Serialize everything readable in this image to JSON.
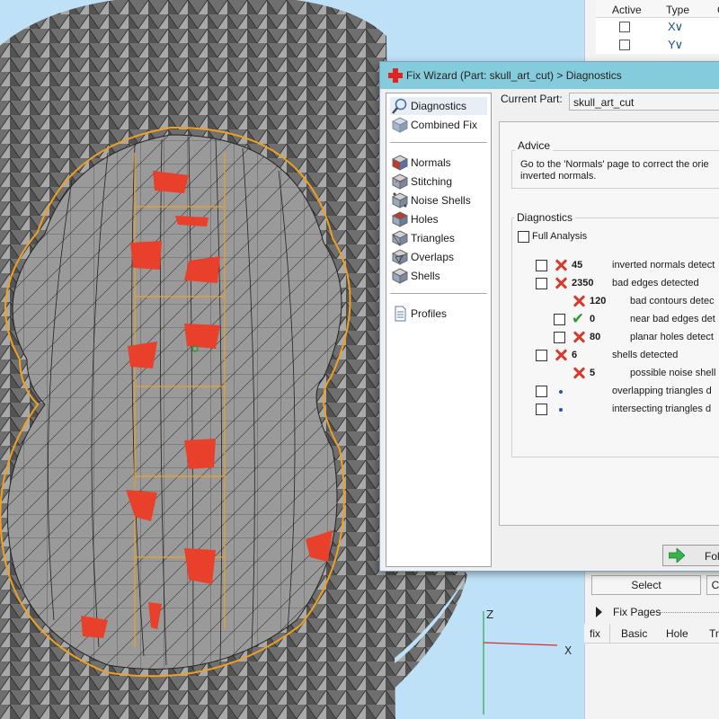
{
  "side_panel": {
    "columns": [
      "Active",
      "Type",
      "C"
    ],
    "rows": [
      {
        "active": false,
        "type_glyph": "X∨"
      },
      {
        "active": false,
        "type_glyph": "Y∨"
      }
    ],
    "select_label": "Select",
    "second_button_label": "C",
    "fix_pages_label": "Fix Pages",
    "tabs": [
      "fix",
      "Basic",
      "Hole",
      "Tri"
    ]
  },
  "viewport": {
    "axis_labels": {
      "z": "Z",
      "x": "X"
    },
    "colors": {
      "mesh": "#8c8c8c",
      "edges": "#1e1e1e",
      "highlight": "#f0a020",
      "bad_triangles": "#e8402a",
      "background": "#bfe1f7"
    }
  },
  "dialog": {
    "title": "Fix Wizard (Part: skull_art_cut) > Diagnostics",
    "nav": [
      {
        "label": "Diagnostics",
        "icon": "magnifier-icon",
        "selected": true
      },
      {
        "label": "Combined Fix",
        "icon": "cube-icon"
      },
      {
        "label": "Normals",
        "icon": "normals-cube-icon"
      },
      {
        "label": "Stitching",
        "icon": "stitching-cube-icon"
      },
      {
        "label": "Noise Shells",
        "icon": "noise-shells-icon"
      },
      {
        "label": "Holes",
        "icon": "holes-cube-icon"
      },
      {
        "label": "Triangles",
        "icon": "triangles-icon"
      },
      {
        "label": "Overlaps",
        "icon": "overlaps-icon"
      },
      {
        "label": "Shells",
        "icon": "shells-icon"
      },
      {
        "label": "Profiles",
        "icon": "document-icon"
      }
    ],
    "current_part_label": "Current Part:",
    "current_part_value": "skull_art_cut",
    "advice_title": "Advice",
    "advice_text": "Go to the 'Normals' page to correct the orie\ninverted normals.",
    "diagnostics_title": "Diagnostics",
    "full_analysis_label": "Full Analysis",
    "items": [
      {
        "checked": true,
        "status": "error",
        "count": "45",
        "label": "inverted normals detect"
      },
      {
        "checked": true,
        "status": "error",
        "count": "2350",
        "label": "bad edges detected"
      },
      {
        "checked": null,
        "status": "error",
        "count": "120",
        "label": "bad contours detec"
      },
      {
        "checked": true,
        "status": "ok",
        "count": "0",
        "label": "near bad edges det"
      },
      {
        "checked": true,
        "status": "error",
        "count": "80",
        "label": "planar holes detect"
      },
      {
        "checked": true,
        "status": "error",
        "count": "6",
        "label": "shells detected"
      },
      {
        "checked": null,
        "status": "error",
        "count": "5",
        "label": "possible noise shell"
      },
      {
        "checked": false,
        "status": "pending",
        "count": "",
        "label": "overlapping triangles d"
      },
      {
        "checked": false,
        "status": "pending",
        "count": "",
        "label": "intersecting triangles d"
      }
    ],
    "follow_button_label": "Fol"
  }
}
